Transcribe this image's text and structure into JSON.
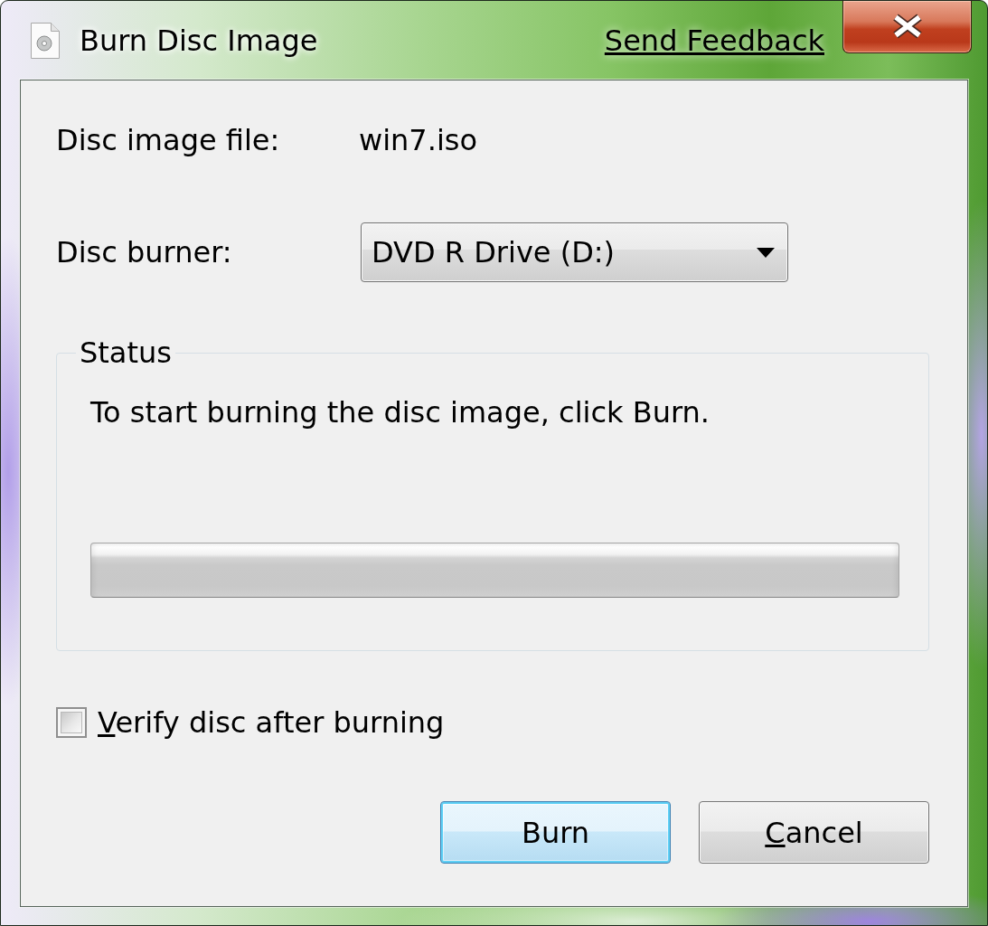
{
  "window": {
    "title": "Burn Disc Image",
    "feedback_link": "Send Feedback"
  },
  "fields": [
    {
      "kind": "text",
      "label": "Disc image file:",
      "value": "win7.iso"
    },
    {
      "kind": "dropdown",
      "label": "Disc burner:",
      "value": "DVD R Drive (D:)"
    }
  ],
  "status": {
    "title": "Status",
    "message": "To start burning the disc image, click Burn.",
    "progress": {
      "level": 0
    }
  },
  "verify": {
    "label": "Verify disc after burning",
    "mnemonic_underlined": true,
    "checked": false
  },
  "buttons": [
    {
      "label": "Burn",
      "mnemonic_underlined": false,
      "default": true
    },
    {
      "label": "Cancel",
      "mnemonic_underlined": true,
      "default": false
    }
  ]
}
